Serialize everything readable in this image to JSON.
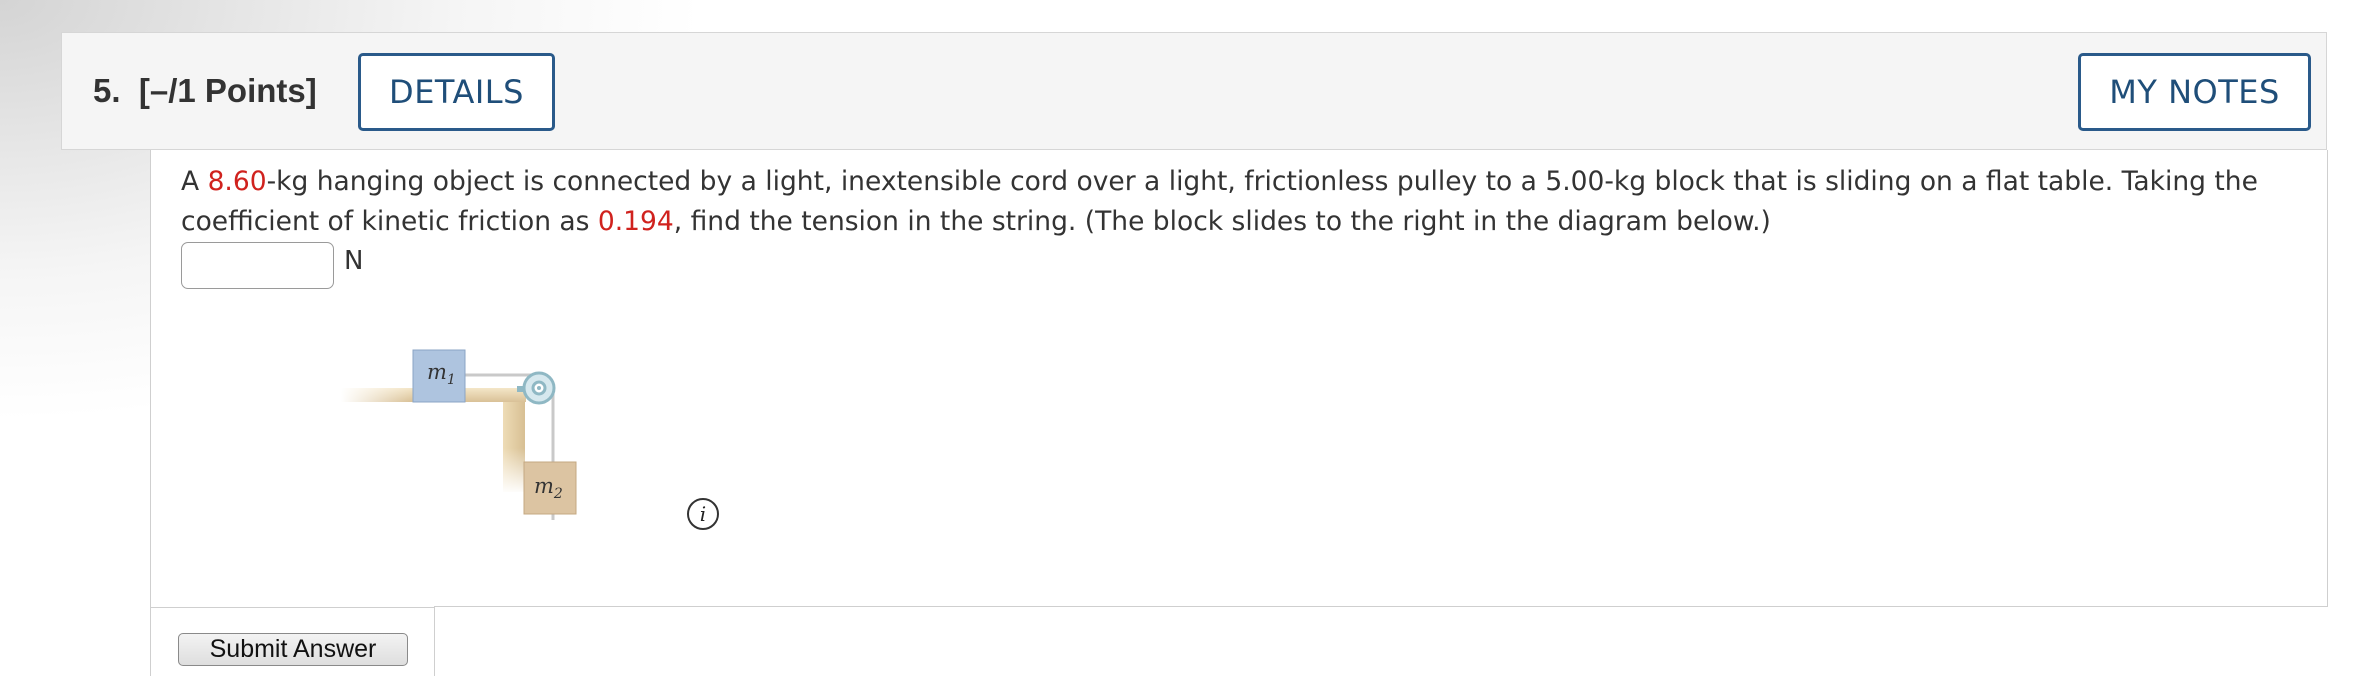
{
  "header": {
    "question_number": "5.",
    "points": "[–/1 Points]",
    "details_label": "DETAILS",
    "notes_label": "MY NOTES"
  },
  "question": {
    "part1": "A ",
    "value_mass": "8.60",
    "part2": "-kg hanging object is connected by a light, inextensible cord over a light, frictionless pulley to a 5.00-kg block that is sliding on a flat table. Taking the coefficient of kinetic friction as ",
    "value_mu": "0.194",
    "part3": ", find the tension in the string. (The block slides to the right in the diagram below.)",
    "highlight_color": "#d0221e"
  },
  "answer": {
    "value": "",
    "placeholder": "",
    "unit": "N"
  },
  "diagram": {
    "block1_label": "m",
    "block1_sub": "1",
    "block2_label": "m",
    "block2_sub": "2"
  },
  "info_icon": {
    "glyph": "i"
  },
  "submit": {
    "label": "Submit Answer"
  },
  "colors": {
    "accent": "#1f4e79",
    "block1": "#aec4df",
    "block2": "#dcc4a2",
    "table": "#e6d2ac"
  }
}
